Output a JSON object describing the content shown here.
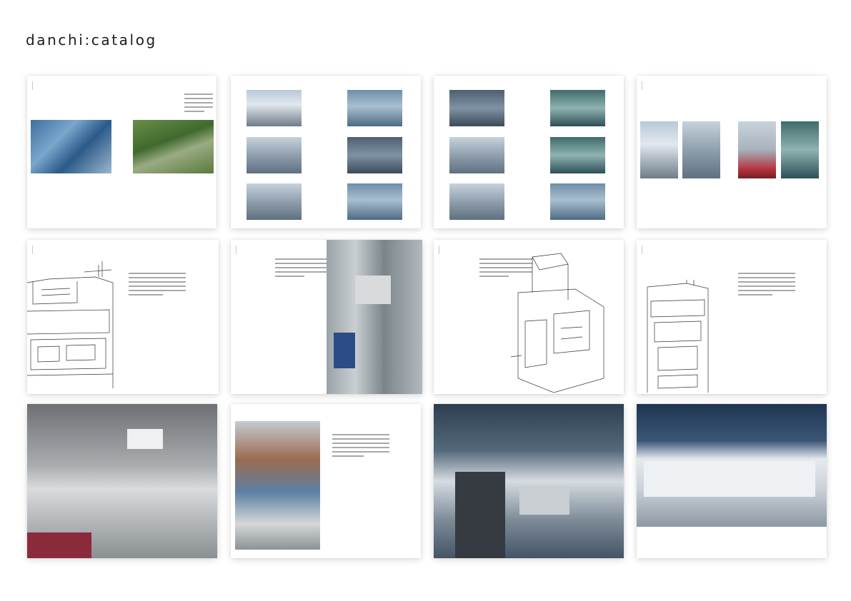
{
  "page": {
    "title": "danchi:catalog"
  },
  "spreads": [
    {
      "id": 1,
      "kind": "two-photos-text"
    },
    {
      "id": 2,
      "kind": "photo-grid-6"
    },
    {
      "id": 3,
      "kind": "photo-grid-6"
    },
    {
      "id": 4,
      "kind": "photo-row-4"
    },
    {
      "id": 5,
      "kind": "sketch-text"
    },
    {
      "id": 6,
      "kind": "text-photo"
    },
    {
      "id": 7,
      "kind": "text-sketch"
    },
    {
      "id": 8,
      "kind": "sketch-text"
    },
    {
      "id": 9,
      "kind": "full-photo"
    },
    {
      "id": 10,
      "kind": "photo-text"
    },
    {
      "id": 11,
      "kind": "full-photo"
    },
    {
      "id": 12,
      "kind": "full-photo"
    }
  ]
}
